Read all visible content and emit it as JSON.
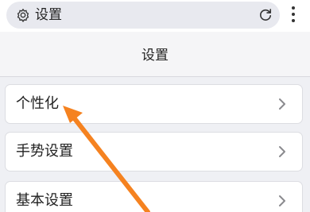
{
  "browser": {
    "url_title": "设置",
    "icons": {
      "site": "gear-icon",
      "reload": "reload-icon",
      "menu": "more-vertical-icon"
    }
  },
  "page": {
    "title": "设置"
  },
  "settings": {
    "items": [
      {
        "label": "个性化",
        "icon": "chevron-right-icon"
      },
      {
        "label": "手势设置",
        "icon": "chevron-right-icon"
      },
      {
        "label": "基本设置",
        "icon": "chevron-right-icon"
      }
    ]
  },
  "colors": {
    "annotation_arrow": "#f58220",
    "background": "#eff0f4"
  }
}
